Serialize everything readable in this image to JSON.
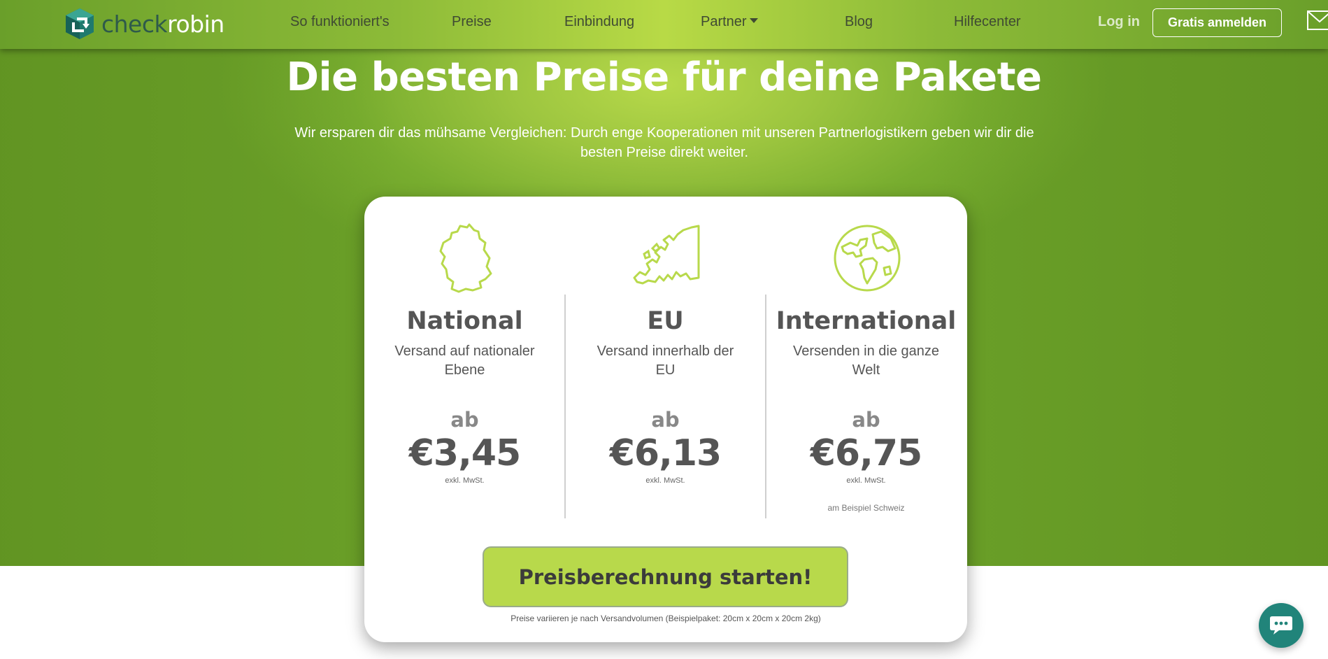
{
  "brand": {
    "name_part1": "check",
    "name_part2": "robin",
    "accent": "#b8d94b",
    "green_dark": "#6a9f28",
    "teal": "#21847a"
  },
  "nav": {
    "items": [
      {
        "label": "So funktioniert's"
      },
      {
        "label": "Preise"
      },
      {
        "label": "Einbindung"
      },
      {
        "label": "Partner"
      },
      {
        "label": "Blog"
      },
      {
        "label": "Hilfecenter"
      }
    ],
    "login": "Log in",
    "signup": "Gratis anmelden",
    "mail_icon": "envelope-icon"
  },
  "hero": {
    "title": "Die besten Preise für deine Pakete",
    "subtitle": "Wir ersparen dir das mühsame Vergleichen: Durch enge Kooperationen mit unseren Partnerlogistikern geben wir dir die besten Preise direkt weiter."
  },
  "pricing": {
    "columns": [
      {
        "icon": "germany-map-icon",
        "title": "National",
        "desc": "Versand auf nationaler Ebene",
        "ab": "ab",
        "price": "€3,45",
        "tax": "exkl. MwSt.",
        "note": ""
      },
      {
        "icon": "europe-map-icon",
        "title": "EU",
        "desc": "Versand innerhalb der EU",
        "ab": "ab",
        "price": "€6,13",
        "tax": "exkl. MwSt.",
        "note": ""
      },
      {
        "icon": "globe-icon",
        "title": "International",
        "desc": "Versenden in die ganze Welt",
        "ab": "ab",
        "price": "€6,75",
        "tax": "exkl. MwSt.",
        "note": "am Beispiel Schweiz"
      }
    ],
    "cta": "Preisberechnung starten!",
    "footnote": "Preise variieren je nach Versandvolumen (Beispielpaket: 20cm x 20cm x 20cm 2kg)"
  },
  "chat": {
    "icon": "chat-bubble-icon"
  }
}
